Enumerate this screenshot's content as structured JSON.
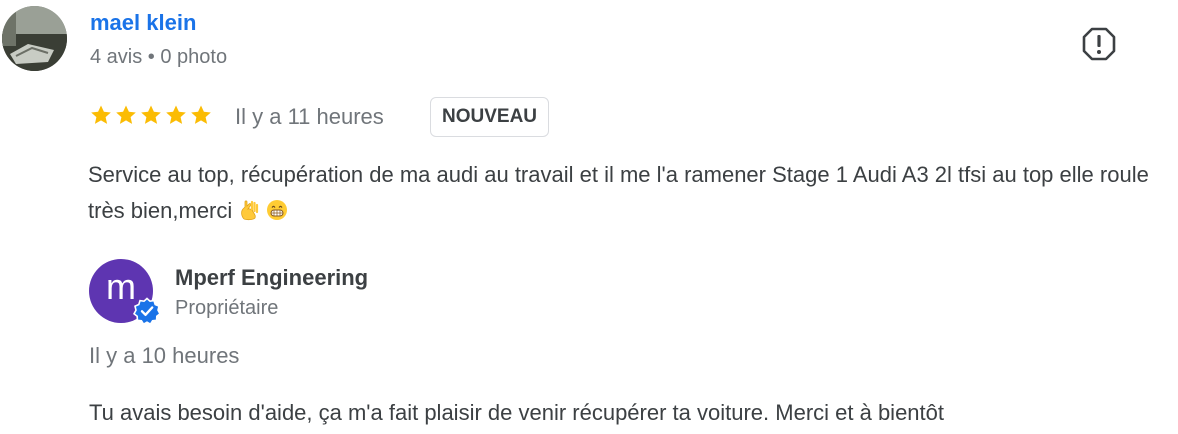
{
  "review": {
    "author_name": "mael klein",
    "author_meta": "4 avis • 0 photo",
    "rating": 5,
    "time": "Il y a 11 heures",
    "badge": "NOUVEAU",
    "text": "Service au top, récupération de ma audi au travail et il me l'a ramener Stage 1 Audi A3 2l tfsi au top elle roule très bien,merci",
    "emojis": [
      "ok-hand-emoji",
      "grinning-face-emoji"
    ],
    "report_icon": "report-icon"
  },
  "reply": {
    "avatar_letter": "m",
    "owner_name": "Mperf Engineering",
    "owner_role": "Propriétaire",
    "time": "Il y a 10 heures",
    "text": "Tu avais besoin d'aide, ça m'a fait plaisir de venir récupérer ta voiture. Merci et à bientôt"
  },
  "colors": {
    "author_link": "#1a73e8",
    "star": "#fbbc04",
    "owner_avatar": "#5e35b1",
    "verified": "#1a73e8"
  }
}
